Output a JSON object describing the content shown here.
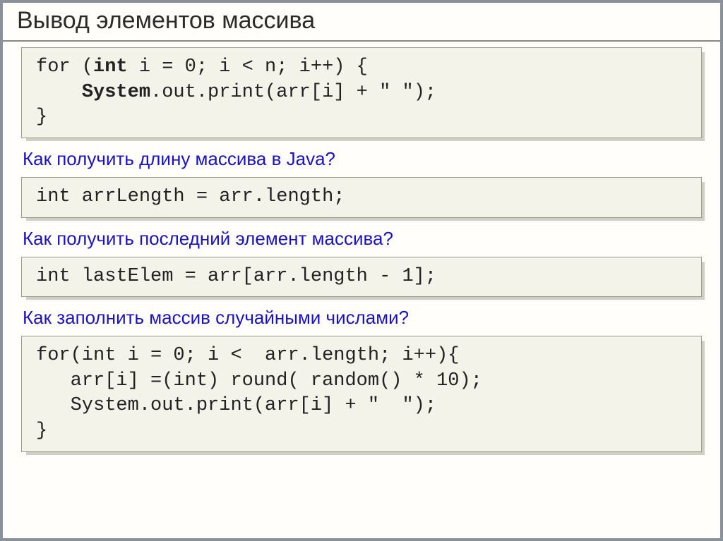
{
  "title": "Вывод элементов массива",
  "blocks": [
    {
      "type": "code",
      "tokens": [
        {
          "t": "for (",
          "kw": false
        },
        {
          "t": "int",
          "kw": true
        },
        {
          "t": " i = 0; i < n; i++) {\n    ",
          "kw": false
        },
        {
          "t": "System",
          "kw": true
        },
        {
          "t": ".out.print(arr[i] + \" \");\n}",
          "kw": false
        }
      ]
    },
    {
      "type": "heading",
      "text": "Как получить длину массива в Java?"
    },
    {
      "type": "code",
      "tokens": [
        {
          "t": "int arrLength = arr.length;",
          "kw": false
        }
      ]
    },
    {
      "type": "heading",
      "text": "Как получить последний элемент массива?"
    },
    {
      "type": "code",
      "tokens": [
        {
          "t": "int lastElem = arr[arr.length - 1];",
          "kw": false
        }
      ]
    },
    {
      "type": "heading",
      "text": "Как заполнить массив случайными  числами?"
    },
    {
      "type": "code",
      "tokens": [
        {
          "t": "for(int i = 0; i <  arr.length; i++){\n   arr[i] =(int) round( random() * 10);\n   System.out.print(arr[i] + \"  \");\n}",
          "kw": false
        }
      ]
    }
  ]
}
